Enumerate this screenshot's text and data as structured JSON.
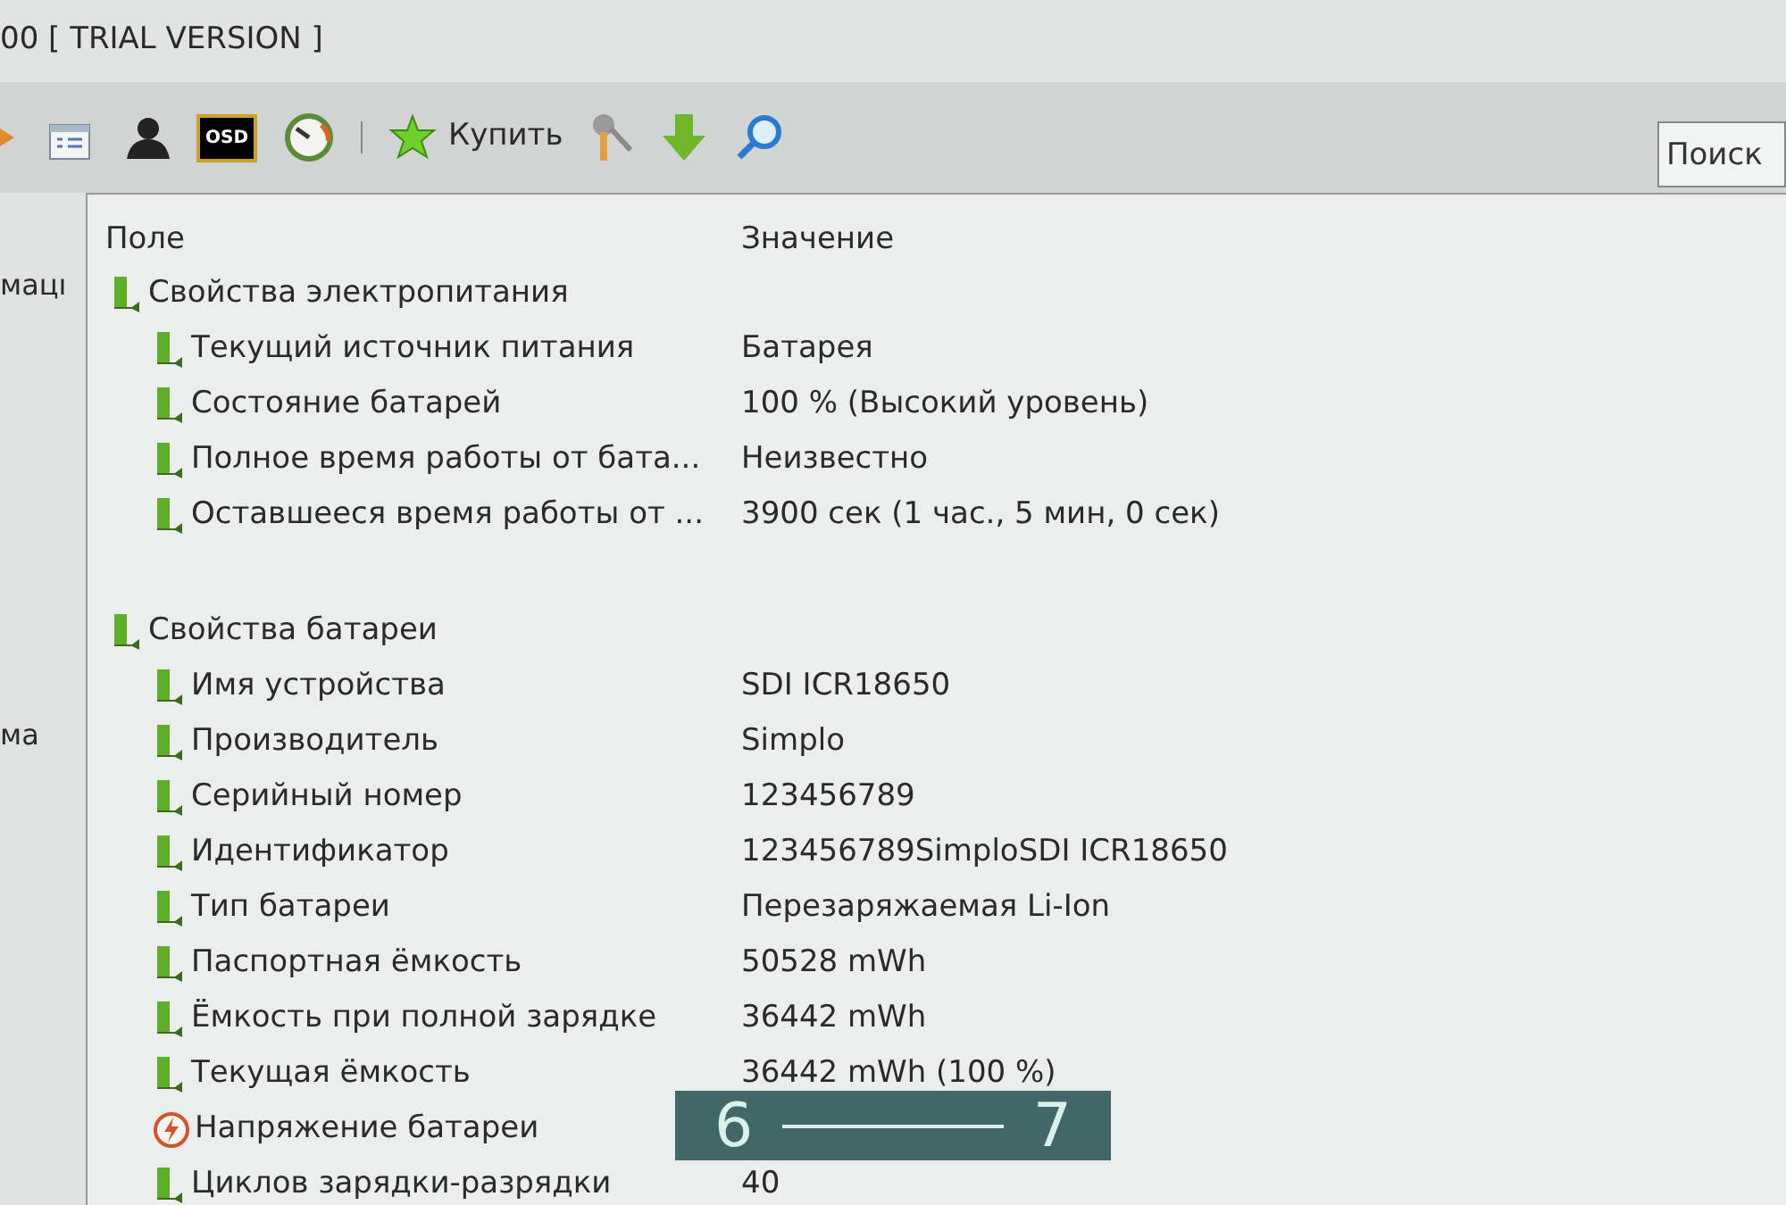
{
  "window": {
    "title": "00  [ TRIAL VERSION ]"
  },
  "toolbar": {
    "items": [
      {
        "kind": "partial"
      },
      {
        "kind": "report"
      },
      {
        "kind": "user"
      },
      {
        "kind": "osd",
        "label": "OSD"
      },
      {
        "kind": "gauge"
      },
      {
        "kind": "separator"
      },
      {
        "kind": "buy",
        "label": "Купить"
      },
      {
        "kind": "tool"
      },
      {
        "kind": "download"
      },
      {
        "kind": "search"
      }
    ],
    "search": {
      "placeholder": "Поиск"
    }
  },
  "left_pane": {
    "items": [
      "мацı",
      "ма"
    ]
  },
  "list": {
    "columns": [
      "Поле",
      "Значение"
    ],
    "groups": [
      {
        "label": "Свойства электропитания",
        "children": [
          {
            "kind": "field",
            "label": "Текущий источник питания",
            "value": "Батарея"
          },
          {
            "kind": "field",
            "label": "Состояние батарей",
            "value": "100 % (Высокий уровень)"
          },
          {
            "kind": "field",
            "label": "Полное время работы от бата...",
            "value": "Неизвестно"
          },
          {
            "kind": "field",
            "label": "Оставшееся время работы от ...",
            "value": "3900 сек (1 час., 5 мин, 0 сек)"
          }
        ]
      },
      {
        "label": "Свойства батареи",
        "children": [
          {
            "kind": "field",
            "label": "Имя устройства",
            "value": "SDI ICR18650"
          },
          {
            "kind": "field",
            "label": "Производитель",
            "value": "Simplo"
          },
          {
            "kind": "field",
            "label": "Серийный номер",
            "value": "123456789"
          },
          {
            "kind": "field",
            "label": "Идентификатор",
            "value": "123456789SimploSDI ICR18650"
          },
          {
            "kind": "field",
            "label": "Тип батареи",
            "value": "Перезаряжаемая Li-Ion"
          },
          {
            "kind": "field",
            "label": "Паспортная ёмкость",
            "value": "50528 mWh"
          },
          {
            "kind": "field",
            "label": "Ёмкость при полной зарядке",
            "value": "36442 mWh"
          },
          {
            "kind": "field",
            "label": "Текущая ёмкость",
            "value": "36442 mWh  (100 %)"
          },
          {
            "kind": "voltage",
            "label": "Напряжение батареи"
          },
          {
            "kind": "field",
            "label": "Циклов зарядки-разрядки",
            "value": "40"
          }
        ]
      }
    ]
  },
  "overlay": {
    "from": "6",
    "to": "7"
  }
}
